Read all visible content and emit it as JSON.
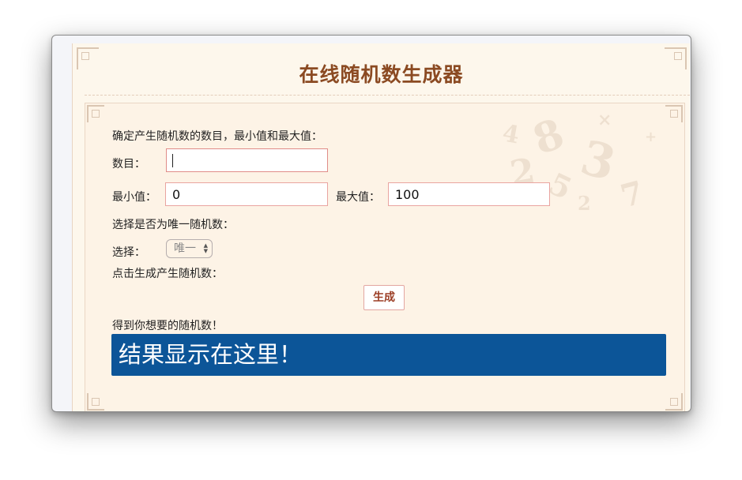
{
  "page": {
    "title": "在线随机数生成器"
  },
  "form": {
    "intro": "确定产生随机数的数目，最小值和最大值：",
    "count_label": "数目：",
    "count_value": "",
    "min_label": "最小值：",
    "min_value": "0",
    "max_label": "最大值：",
    "max_value": "100",
    "unique_intro": "选择是否为唯一随机数：",
    "select_label": "选择：",
    "select_value": "唯一",
    "generate_intro": "点击生成产生随机数：",
    "generate_button": "生成",
    "result_intro": "得到你想要的随机数！",
    "result_text": "结果显示在这里！"
  },
  "colors": {
    "title": "#8b4a22",
    "result_bg": "#0c5598",
    "panel_bg": "#fdf3e6",
    "field_border": "#e9a4a0"
  }
}
